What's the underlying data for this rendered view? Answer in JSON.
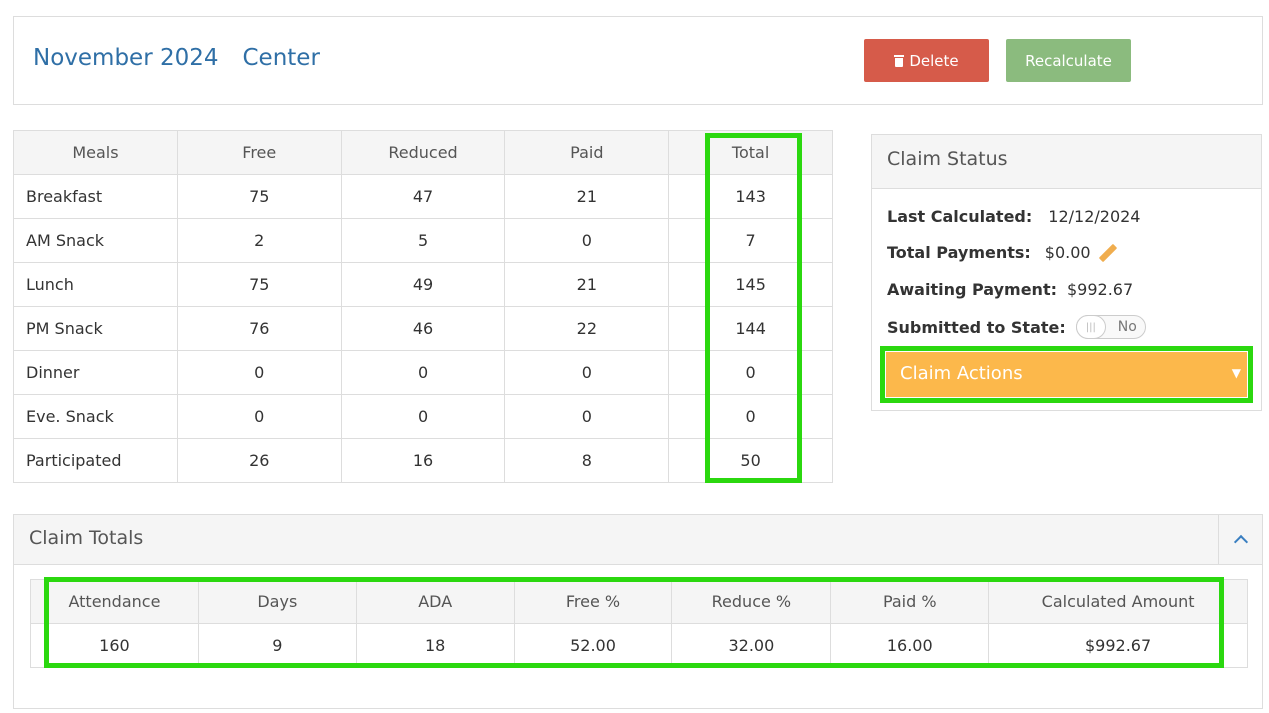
{
  "header": {
    "period": "November 2024",
    "type": "Center",
    "delete_label": "Delete",
    "recalculate_label": "Recalculate"
  },
  "meals": {
    "columns": [
      "Meals",
      "Free",
      "Reduced",
      "Paid",
      "Total"
    ],
    "rows": [
      [
        "Breakfast",
        "75",
        "47",
        "21",
        "143"
      ],
      [
        "AM Snack",
        "2",
        "5",
        "0",
        "7"
      ],
      [
        "Lunch",
        "75",
        "49",
        "21",
        "145"
      ],
      [
        "PM Snack",
        "76",
        "46",
        "22",
        "144"
      ],
      [
        "Dinner",
        "0",
        "0",
        "0",
        "0"
      ],
      [
        "Eve. Snack",
        "0",
        "0",
        "0",
        "0"
      ],
      [
        "Participated",
        "26",
        "16",
        "8",
        "50"
      ]
    ]
  },
  "claim_status": {
    "title": "Claim Status",
    "last_calculated_label": "Last Calculated:",
    "last_calculated": "12/12/2024",
    "total_payments_label": "Total Payments:",
    "total_payments": "$0.00",
    "awaiting_payment_label": "Awaiting Payment:",
    "awaiting_payment": "$992.67",
    "submitted_label": "Submitted to State:",
    "submitted_value": "No",
    "actions_label": "Claim Actions"
  },
  "claim_totals": {
    "title": "Claim Totals",
    "columns": [
      "Attendance",
      "Days",
      "ADA",
      "Free %",
      "Reduce %",
      "Paid %",
      "Calculated Amount"
    ],
    "values": [
      "160",
      "9",
      "18",
      "52.00",
      "32.00",
      "16.00",
      "$992.67"
    ]
  },
  "colors": {
    "delete": "#d65b4a",
    "recalculate": "#8bbb7e",
    "claim_actions": "#fcb84b",
    "highlight": "#2bd80f",
    "title": "#2f6fa6"
  },
  "icons": [
    "trash-icon",
    "pencil-icon",
    "caret-down-icon",
    "chevron-up-icon"
  ]
}
